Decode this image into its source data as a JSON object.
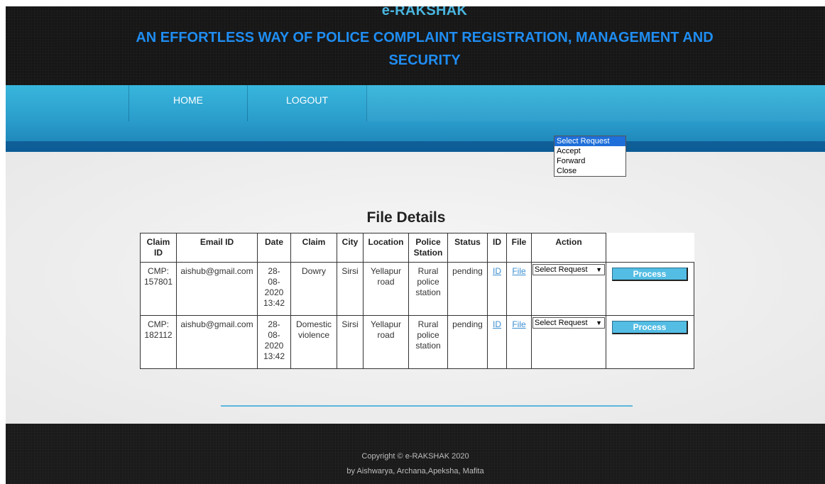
{
  "header": {
    "brand": "e-RAKSHAK",
    "tagline": "AN EFFORTLESS WAY OF POLICE COMPLAINT REGISTRATION, MANAGEMENT AND SECURITY"
  },
  "nav": {
    "home": "HOME",
    "logout": "LOGOUT"
  },
  "main": {
    "title": "File Details",
    "columns": [
      "Claim ID",
      "Email ID",
      "Date",
      "Claim",
      "City",
      "Location",
      "Police Station",
      "Status",
      "ID",
      "File",
      "Action"
    ],
    "rows": [
      {
        "claim_id": "CMP: 157801",
        "email": "aishub@gmail.com",
        "date": "28- 08- 2020 13:42",
        "claim": "Dowry",
        "city": "Sirsi",
        "location": "Yellapur road",
        "station": "Rural police station",
        "status": "pending",
        "id_link": "ID",
        "file_link": "File",
        "action_selected": "Select Request",
        "process": "Process"
      },
      {
        "claim_id": "CMP: 182112",
        "email": "aishub@gmail.com",
        "date": "28- 08- 2020 13:42",
        "claim": "Domestic violence",
        "city": "Sirsi",
        "location": "Yellapur road",
        "station": "Rural police station",
        "status": "pending",
        "id_link": "ID",
        "file_link": "File",
        "action_selected": "Select Request",
        "process": "Process"
      }
    ],
    "action_options": [
      "Select Request",
      "Accept",
      "Forward",
      "Close"
    ]
  },
  "footer": {
    "copyright": "Copyright © e-RAKSHAK 2020",
    "authors": "by Aishwarya, Archana,Apeksha, Mafita"
  },
  "colors": {
    "brand": "#4ab6e0",
    "tagline": "#1f8df2",
    "nav": "#2a9ccb",
    "button": "#53bde4",
    "selected_option": "#1e6fd9"
  }
}
